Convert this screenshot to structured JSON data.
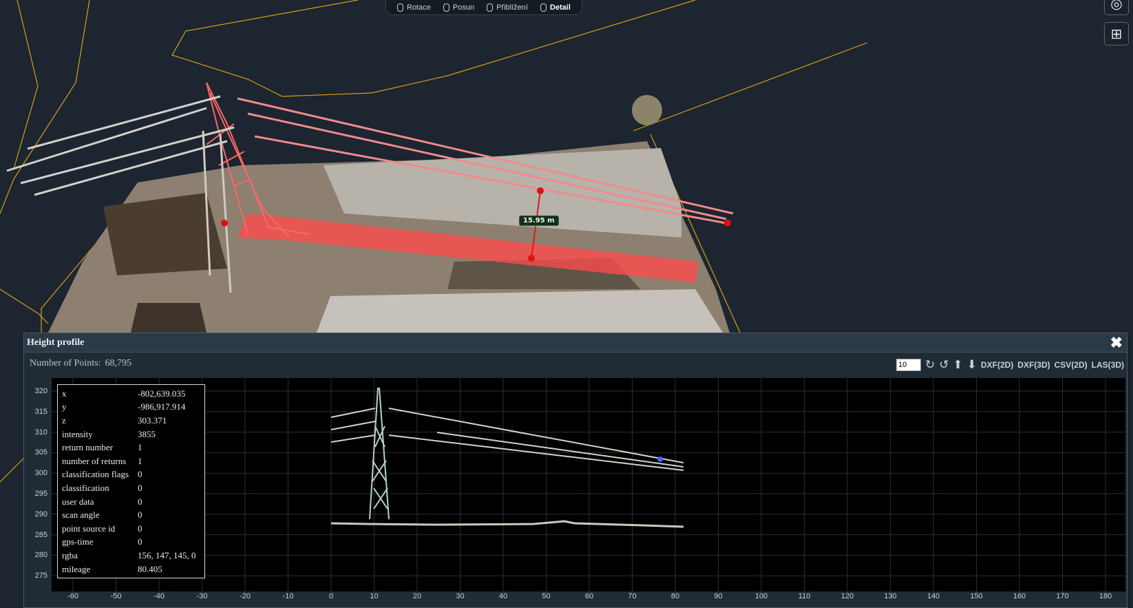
{
  "toolbar": {
    "hints": [
      {
        "icon": "mouse-icon",
        "label": "Rotace"
      },
      {
        "icon": "mouse-icon",
        "label": "Posun"
      },
      {
        "icon": "mouse-icon",
        "label": "Přiblížení"
      },
      {
        "icon": "mouse-double-icon",
        "label": "Detail"
      }
    ]
  },
  "side_buttons": [
    {
      "name": "target-icon",
      "glyph": "◎"
    },
    {
      "name": "grid-layout-icon",
      "glyph": "⊞"
    }
  ],
  "measurement": {
    "label": "15.95 m"
  },
  "profile": {
    "title": "Height profile",
    "close_glyph": "✖",
    "points_label": "Number of Points:",
    "points_value": "68,795",
    "point_budget": "10",
    "icons": {
      "rotate_cw": "↻",
      "rotate_ccw": "↺",
      "up": "⬆",
      "down": "⬇"
    },
    "exports": [
      "DXF(2D)",
      "DXF(3D)",
      "CSV(2D)",
      "LAS(3D)"
    ],
    "y_ticks": [
      "320",
      "315",
      "310",
      "305",
      "300",
      "295",
      "290",
      "285",
      "280",
      "275"
    ],
    "x_ticks": [
      "-60",
      "-50",
      "-40",
      "-30",
      "-20",
      "-10",
      "0",
      "10",
      "20",
      "30",
      "40",
      "50",
      "60",
      "70",
      "80",
      "90",
      "100",
      "110",
      "120",
      "130",
      "140",
      "150",
      "160",
      "170",
      "180"
    ],
    "point_info": [
      {
        "key": "x",
        "value": "-802,639.035"
      },
      {
        "key": "y",
        "value": "-986,917.914"
      },
      {
        "key": "z",
        "value": "303.371"
      },
      {
        "key": "intensity",
        "value": "3855"
      },
      {
        "key": "return number",
        "value": "1"
      },
      {
        "key": "number of returns",
        "value": "1"
      },
      {
        "key": "classification flags",
        "value": "0"
      },
      {
        "key": "classification",
        "value": "0"
      },
      {
        "key": "user data",
        "value": "0"
      },
      {
        "key": "scan angle",
        "value": "0"
      },
      {
        "key": "point source id",
        "value": "0"
      },
      {
        "key": "gps-time",
        "value": "0"
      },
      {
        "key": "rgba",
        "value": "156, 147, 145, 0"
      },
      {
        "key": "mileage",
        "value": "80.405"
      }
    ]
  },
  "colors": {
    "background": "#1c2530",
    "boundary": "#d9a017",
    "highlight": "#ff4b4b",
    "measure_point": "#e01010"
  }
}
